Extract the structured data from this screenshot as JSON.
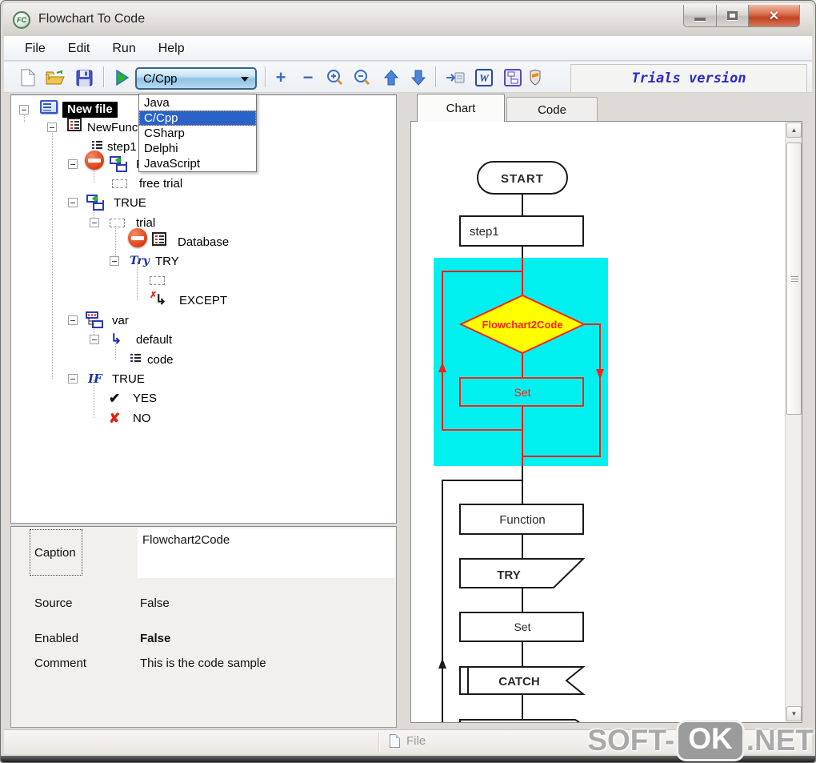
{
  "window": {
    "title": "Flowchart To Code",
    "icon_text": "FC"
  },
  "menu": {
    "items": [
      {
        "label": "File"
      },
      {
        "label": "Edit"
      },
      {
        "label": "Run"
      },
      {
        "label": "Help"
      }
    ]
  },
  "toolbar": {
    "trials_label": "Trials version",
    "language_combo": {
      "value": "C/Cpp"
    },
    "dropdown": {
      "selected": "C/Cpp",
      "options": [
        {
          "label": "Java"
        },
        {
          "label": "C/Cpp"
        },
        {
          "label": "CSharp"
        },
        {
          "label": "Delphi"
        },
        {
          "label": "JavaScript"
        }
      ]
    }
  },
  "tree": {
    "items": [
      {
        "label": "New file"
      },
      {
        "label": "NewFunction"
      },
      {
        "label": "step1"
      },
      {
        "label": "Flowchart2Code"
      },
      {
        "label": "free trial"
      },
      {
        "label": "TRUE"
      },
      {
        "label": "trial"
      },
      {
        "label": "Database"
      },
      {
        "label": "TRY"
      },
      {
        "label": ""
      },
      {
        "label": "EXCEPT"
      },
      {
        "label": "var"
      },
      {
        "label": "default"
      },
      {
        "label": "code"
      },
      {
        "label": "TRUE"
      },
      {
        "label": "YES"
      },
      {
        "label": "NO"
      }
    ]
  },
  "properties": {
    "caption_label": "Caption",
    "caption_value": "Flowchart2Code",
    "rows": [
      {
        "label": "Source",
        "value": "False"
      },
      {
        "label": "Enabled",
        "value": "False"
      },
      {
        "label": "Comment",
        "value": "This is the code sample"
      }
    ]
  },
  "tabs": {
    "chart": "Chart",
    "code": "Code"
  },
  "flowchart": {
    "nodes": {
      "start": "START",
      "step1": "step1",
      "decision": "Flowchart2Code",
      "set1": "Set",
      "function": "Function",
      "try": "TRY",
      "set2": "Set",
      "catch": "CATCH"
    },
    "colors": {
      "loop_region": "#00f0f0",
      "decision_fill": "#ffff00",
      "highlight": "#ff2016",
      "line": "#1a1a1a"
    }
  },
  "statusbar": {
    "file_label": "File"
  },
  "watermark": {
    "prefix": "SOFT-",
    "ok": "OK",
    "suffix": ".NET"
  },
  "colors": {
    "combo_border": "#36648f",
    "selection_blue": "#2a63c8",
    "trials_text": "#2a2ac8",
    "close_button": "#c24324"
  }
}
